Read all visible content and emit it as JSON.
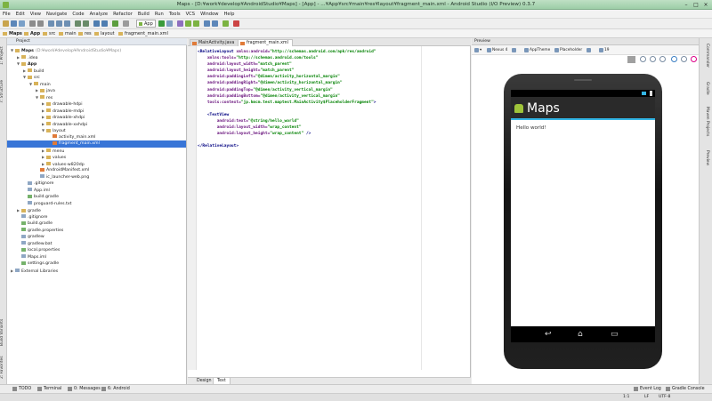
{
  "window": {
    "title": "Maps - [D:¥work¥develop¥AndroidStudio¥Maps] - [App] - ...¥App¥src¥main¥res¥layout¥fragment_main.xml - Android Studio (I/O Preview) 0.3.7"
  },
  "menu": [
    "File",
    "Edit",
    "View",
    "Navigate",
    "Code",
    "Analyze",
    "Refactor",
    "Build",
    "Run",
    "Tools",
    "VCS",
    "Window",
    "Help"
  ],
  "toolbar": {
    "run_config": "App"
  },
  "breadcrumbs": [
    "Maps",
    "App",
    "src",
    "main",
    "res",
    "layout",
    "fragment_main.xml"
  ],
  "project": {
    "header": "Project",
    "tree": [
      {
        "label": "Maps",
        "extra": "(D:¥work¥develop¥AndroidStudio¥Maps)",
        "level": 0,
        "arrow": "▼",
        "icon": "fold",
        "bold": true
      },
      {
        "label": ".idea",
        "level": 1,
        "arrow": "▶",
        "icon": "fold"
      },
      {
        "label": "App",
        "level": 1,
        "arrow": "▼",
        "icon": "fold",
        "bold": true
      },
      {
        "label": "build",
        "level": 2,
        "arrow": "▶",
        "icon": "fold"
      },
      {
        "label": "src",
        "level": 2,
        "arrow": "▼",
        "icon": "fold"
      },
      {
        "label": "main",
        "level": 3,
        "arrow": "▼",
        "icon": "fold"
      },
      {
        "label": "java",
        "level": 4,
        "arrow": "▶",
        "icon": "fold"
      },
      {
        "label": "res",
        "level": 4,
        "arrow": "▼",
        "icon": "fold"
      },
      {
        "label": "drawable-hdpi",
        "level": 5,
        "arrow": "▶",
        "icon": "fold"
      },
      {
        "label": "drawable-mdpi",
        "level": 5,
        "arrow": "▶",
        "icon": "fold"
      },
      {
        "label": "drawable-xhdpi",
        "level": 5,
        "arrow": "▶",
        "icon": "fold"
      },
      {
        "label": "drawable-xxhdpi",
        "level": 5,
        "arrow": "▶",
        "icon": "fold"
      },
      {
        "label": "layout",
        "level": 5,
        "arrow": "▼",
        "icon": "fold"
      },
      {
        "label": "activity_main.xml",
        "level": 6,
        "arrow": "",
        "icon": "xmlic"
      },
      {
        "label": "fragment_main.xml",
        "level": 6,
        "arrow": "",
        "icon": "xmlic",
        "selected": true
      },
      {
        "label": "menu",
        "level": 5,
        "arrow": "▶",
        "icon": "fold"
      },
      {
        "label": "values",
        "level": 5,
        "arrow": "▶",
        "icon": "fold"
      },
      {
        "label": "values-w820dp",
        "level": 5,
        "arrow": "▶",
        "icon": "fold"
      },
      {
        "label": "AndroidManifest.xml",
        "level": 4,
        "arrow": "",
        "icon": "xmlic"
      },
      {
        "label": "ic_launcher-web.png",
        "level": 4,
        "arrow": "",
        "icon": "fileic"
      },
      {
        "label": ".gitignore",
        "level": 2,
        "arrow": "",
        "icon": "fileic"
      },
      {
        "label": "App.iml",
        "level": 2,
        "arrow": "",
        "icon": "fileic"
      },
      {
        "label": "build.gradle",
        "level": 2,
        "arrow": "",
        "icon": "grad"
      },
      {
        "label": "proguard-rules.txt",
        "level": 2,
        "arrow": "",
        "icon": "fileic"
      },
      {
        "label": "gradle",
        "level": 1,
        "arrow": "▶",
        "icon": "fold"
      },
      {
        "label": ".gitignore",
        "level": 1,
        "arrow": "",
        "icon": "fileic"
      },
      {
        "label": "build.gradle",
        "level": 1,
        "arrow": "",
        "icon": "grad"
      },
      {
        "label": "gradle.properties",
        "level": 1,
        "arrow": "",
        "icon": "grad"
      },
      {
        "label": "gradlew",
        "level": 1,
        "arrow": "",
        "icon": "fileic"
      },
      {
        "label": "gradlew.bat",
        "level": 1,
        "arrow": "",
        "icon": "fileic"
      },
      {
        "label": "local.properties",
        "level": 1,
        "arrow": "",
        "icon": "grad"
      },
      {
        "label": "Maps.iml",
        "level": 1,
        "arrow": "",
        "icon": "fileic"
      },
      {
        "label": "settings.gradle",
        "level": 1,
        "arrow": "",
        "icon": "grad"
      },
      {
        "label": "External Libraries",
        "level": 0,
        "arrow": "▶",
        "icon": "fileic"
      }
    ]
  },
  "editor": {
    "tabs": [
      "MainActivity.java",
      "fragment_main.xml"
    ],
    "active_tab": 1,
    "code": [
      [
        [
          "tag",
          "<RelativeLayout "
        ],
        [
          "attr",
          "xmlns:android="
        ],
        [
          "val",
          "\"http://schemas.android.com/apk/res/android\""
        ]
      ],
      [
        [
          "sp",
          "    "
        ],
        [
          "attr",
          "xmlns:tools="
        ],
        [
          "val",
          "\"http://schemas.android.com/tools\""
        ]
      ],
      [
        [
          "sp",
          "    "
        ],
        [
          "attr",
          "android:layout_width="
        ],
        [
          "val",
          "\"match_parent\""
        ]
      ],
      [
        [
          "sp",
          "    "
        ],
        [
          "attr",
          "android:layout_height="
        ],
        [
          "val",
          "\"match_parent\""
        ]
      ],
      [
        [
          "sp",
          "    "
        ],
        [
          "attr",
          "android:paddingLeft="
        ],
        [
          "val",
          "\"@dimen/activity_horizontal_margin\""
        ]
      ],
      [
        [
          "sp",
          "    "
        ],
        [
          "attr",
          "android:paddingRight="
        ],
        [
          "val",
          "\"@dimen/activity_horizontal_margin\""
        ]
      ],
      [
        [
          "sp",
          "    "
        ],
        [
          "attr",
          "android:paddingTop="
        ],
        [
          "val",
          "\"@dimen/activity_vertical_margin\""
        ]
      ],
      [
        [
          "sp",
          "    "
        ],
        [
          "attr",
          "android:paddingBottom="
        ],
        [
          "val",
          "\"@dimen/activity_vertical_margin\""
        ]
      ],
      [
        [
          "sp",
          "    "
        ],
        [
          "attr",
          "tools:context="
        ],
        [
          "val",
          "\"jp.hmcm.test.maptest.MainActivity$PlaceholderFragment\""
        ],
        [
          "tag",
          ">"
        ]
      ],
      [
        [
          "sp",
          ""
        ]
      ],
      [
        [
          "sp",
          "    "
        ],
        [
          "tag",
          "<TextView"
        ]
      ],
      [
        [
          "sp",
          "        "
        ],
        [
          "attr",
          "android:text="
        ],
        [
          "val",
          "\"@string/hello_world\""
        ]
      ],
      [
        [
          "sp",
          "        "
        ],
        [
          "attr",
          "android:layout_width="
        ],
        [
          "val",
          "\"wrap_content\""
        ]
      ],
      [
        [
          "sp",
          "        "
        ],
        [
          "attr",
          "android:layout_height="
        ],
        [
          "val",
          "\"wrap_content\""
        ],
        [
          "tag",
          " />"
        ]
      ],
      [
        [
          "sp",
          ""
        ]
      ],
      [
        [
          "tag",
          "</RelativeLayout>"
        ]
      ]
    ],
    "bottom_tabs": [
      "Design",
      "Text"
    ],
    "active_bottom": 1
  },
  "preview": {
    "header": "Preview",
    "device": "Nexus 4",
    "api": "19",
    "theme": "AppTheme",
    "activity": "Placeholder",
    "app_title": "Maps",
    "hello": "Hello world!"
  },
  "left_tools": [
    "1: Project",
    "7: Structure",
    "Build Variants",
    "2: Favorites"
  ],
  "right_tools": [
    "Commander",
    "Gradle",
    "Maven Projects",
    "Preview"
  ],
  "bottom_tools": [
    "TODO",
    "Terminal",
    "0: Messages",
    "6: Android"
  ],
  "bottom_right": [
    "Event Log",
    "Gradle Console"
  ],
  "status": {
    "position": "1:1",
    "line_sep": "LF",
    "encoding": "UTF-8"
  }
}
